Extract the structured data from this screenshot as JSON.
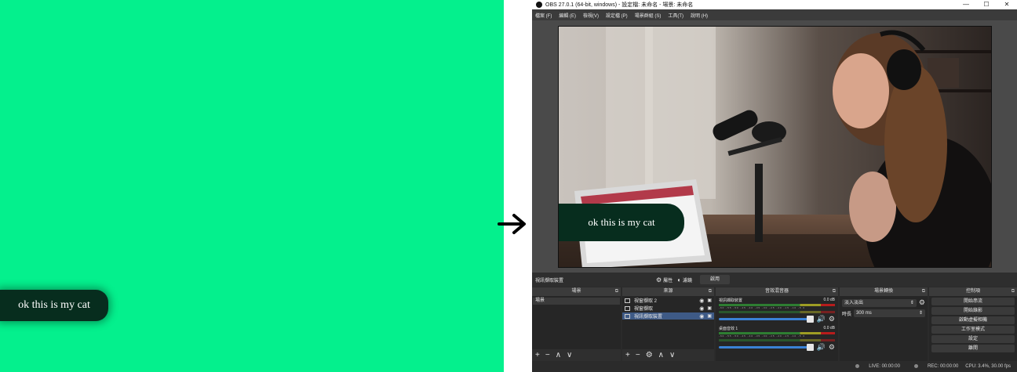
{
  "caption": {
    "text": "ok this is my cat"
  },
  "window": {
    "title": "OBS 27.0.1 (64-bit, windows) - 設定檔: 未命名 - 場景: 未命名",
    "controls": {
      "minimize": "—",
      "maximize": "☐",
      "close": "✕"
    }
  },
  "menu": [
    "檔案 (F)",
    "編輯 (E)",
    "檢視(V)",
    "設定檔 (P)",
    "場景群組 (S)",
    "工具(T)",
    "說明 (H)"
  ],
  "source_bar": {
    "name": "視訊擷取裝置",
    "properties_label": "屬性",
    "filters_label": "濾鏡",
    "activate_label": "啟用"
  },
  "scenes": {
    "title": "場景",
    "items": [
      "場景"
    ]
  },
  "sources": {
    "title": "來源",
    "items": [
      {
        "label": "視窗擷取 2",
        "selected": false
      },
      {
        "label": "視窗擷取",
        "selected": false
      },
      {
        "label": "視訊擷取裝置",
        "selected": true
      }
    ]
  },
  "mixer": {
    "title": "音效混音器",
    "channels": [
      {
        "name": "視訊擷取裝置",
        "db": "0.0 dB"
      },
      {
        "name": "桌面音效 1",
        "db": "0.0 dB"
      }
    ],
    "ticks": "-60 -55 -50 -45 -40 -35 -30 -25 -20 -15 -10 -5 0"
  },
  "transitions": {
    "title": "場景轉換",
    "type": "淡入淡出",
    "duration_label": "時長",
    "duration": "300 ms"
  },
  "controls": {
    "title": "控制項",
    "buttons": [
      "開始串流",
      "開始錄影",
      "啟動虛擬相機",
      "工作室模式",
      "設定",
      "離開"
    ]
  },
  "status": {
    "live": "LIVE: 00:00:00",
    "rec": "REC: 00:00:00",
    "cpu": "CPU: 3.4%, 30.00 fps"
  },
  "icons": {
    "add": "+",
    "remove": "−",
    "up": "∧",
    "down": "∨",
    "gear": "⚙",
    "eye": "👁",
    "lock": "🔒",
    "speaker": "🔊",
    "float": "⧉"
  },
  "colors": {
    "chroma_green": "#04f08d",
    "caption_bg": "#072d1e",
    "selection": "#3e5a86",
    "fader": "#3a82d6"
  }
}
